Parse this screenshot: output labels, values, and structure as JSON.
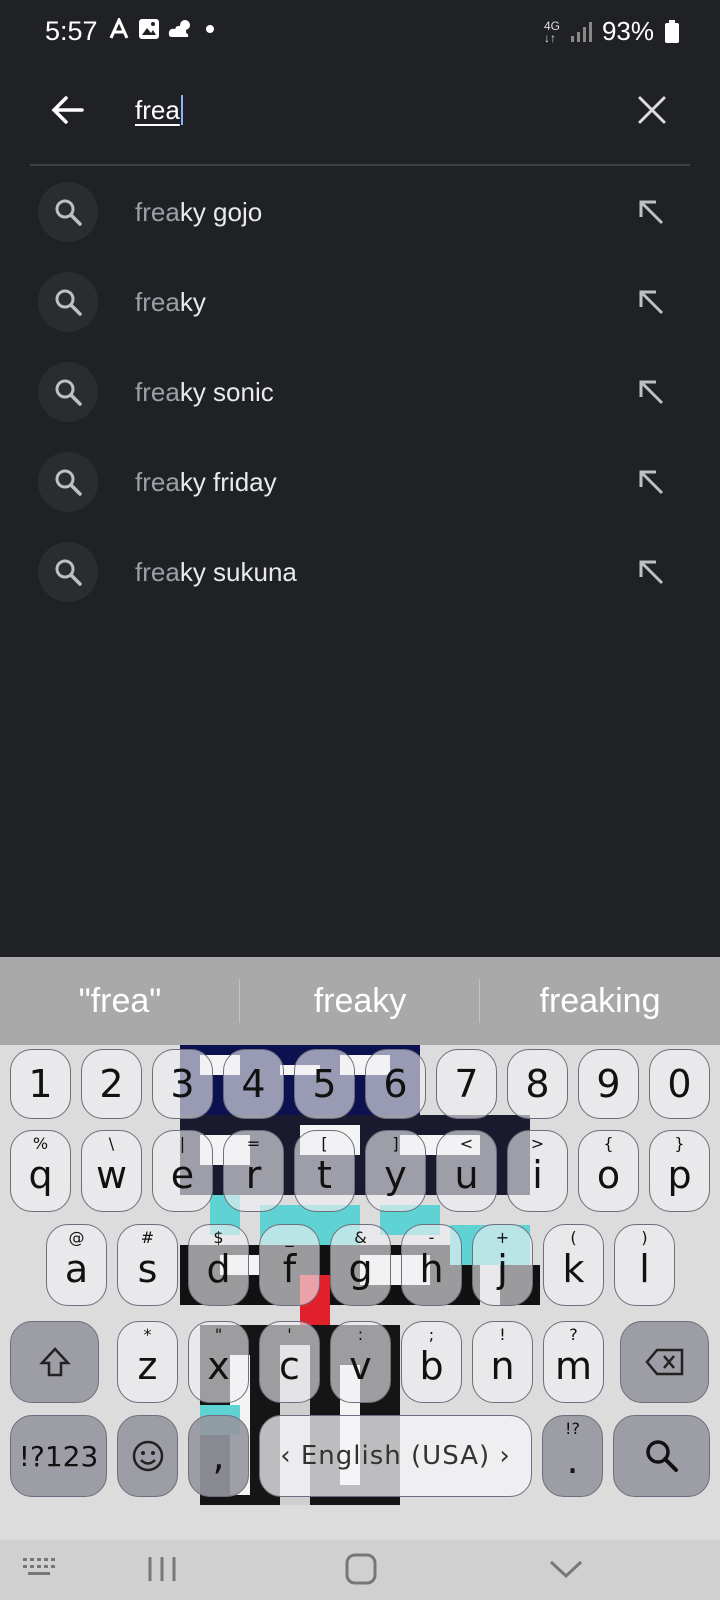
{
  "status_bar": {
    "time": "5:57",
    "network": "4G",
    "battery": "93%",
    "icons": [
      "accessibility-a-icon",
      "image-icon",
      "weather-icon",
      "dot-icon",
      "signal-icon",
      "battery-icon"
    ]
  },
  "search": {
    "query": "frea",
    "back_icon": "arrow-back-icon",
    "clear_icon": "close-icon"
  },
  "suggestions": [
    {
      "prefix": "frea",
      "rest": "ky gojo"
    },
    {
      "prefix": "frea",
      "rest": "ky"
    },
    {
      "prefix": "frea",
      "rest": "ky sonic"
    },
    {
      "prefix": "frea",
      "rest": "ky friday"
    },
    {
      "prefix": "frea",
      "rest": "ky sukuna"
    }
  ],
  "keyboard": {
    "predictions": [
      "\"frea\"",
      "freaky",
      "freaking"
    ],
    "number_row": [
      "1",
      "2",
      "3",
      "4",
      "5",
      "6",
      "7",
      "8",
      "9",
      "0"
    ],
    "row1": [
      {
        "main": "q",
        "sub": "%"
      },
      {
        "main": "w",
        "sub": "\\"
      },
      {
        "main": "e",
        "sub": "|"
      },
      {
        "main": "r",
        "sub": "="
      },
      {
        "main": "t",
        "sub": "["
      },
      {
        "main": "y",
        "sub": "]"
      },
      {
        "main": "u",
        "sub": "<"
      },
      {
        "main": "i",
        "sub": ">"
      },
      {
        "main": "o",
        "sub": "{"
      },
      {
        "main": "p",
        "sub": "}"
      }
    ],
    "row2": [
      {
        "main": "a",
        "sub": "@"
      },
      {
        "main": "s",
        "sub": "#"
      },
      {
        "main": "d",
        "sub": "$"
      },
      {
        "main": "f",
        "sub": "_"
      },
      {
        "main": "g",
        "sub": "&"
      },
      {
        "main": "h",
        "sub": "-"
      },
      {
        "main": "j",
        "sub": "+"
      },
      {
        "main": "k",
        "sub": "("
      },
      {
        "main": "l",
        "sub": ")"
      }
    ],
    "row3": [
      {
        "main": "z",
        "sub": "*"
      },
      {
        "main": "x",
        "sub": "\""
      },
      {
        "main": "c",
        "sub": "'"
      },
      {
        "main": "v",
        "sub": ":"
      },
      {
        "main": "b",
        "sub": ";"
      },
      {
        "main": "n",
        "sub": "!"
      },
      {
        "main": "m",
        "sub": "?"
      }
    ],
    "symbols_label": "!?123",
    "comma": ",",
    "space_label": "English (USA)",
    "punct_label": "!?",
    "punct_main": ".",
    "shift_icon": "shift-icon",
    "backspace_icon": "backspace-icon",
    "emoji_icon": "emoji-icon",
    "search_icon": "search-icon",
    "colors": {
      "navy": "#0c1150",
      "cyan": "#5fd3d3",
      "red": "#e0202a"
    }
  },
  "nav_bar": {
    "icons": [
      "keyboard-hide-icon",
      "recents-icon",
      "home-icon",
      "back-chevron-icon"
    ]
  }
}
